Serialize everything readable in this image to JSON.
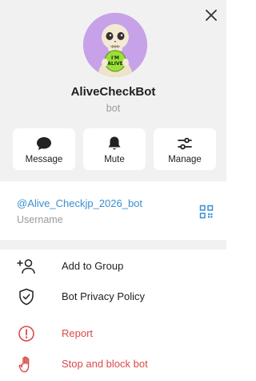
{
  "profile": {
    "name": "AliveCheckBot",
    "subtitle": "bot",
    "avatar_badge_line1": "I'M",
    "avatar_badge_line2": "ALIVE"
  },
  "actions": [
    {
      "label": "Message",
      "icon": "message-bubble-icon"
    },
    {
      "label": "Mute",
      "icon": "bell-icon"
    },
    {
      "label": "Manage",
      "icon": "sliders-icon"
    }
  ],
  "username": {
    "value": "@Alive_Checkjp_2026_bot",
    "label": "Username"
  },
  "menu": [
    {
      "label": "Add to Group",
      "icon": "add-user-icon",
      "danger": false
    },
    {
      "label": "Bot Privacy Policy",
      "icon": "shield-check-icon",
      "danger": false
    },
    {
      "label": "Report",
      "icon": "alert-circle-icon",
      "danger": true
    },
    {
      "label": "Stop and block bot",
      "icon": "hand-stop-icon",
      "danger": true
    }
  ],
  "colors": {
    "header_bg": "#f1f1f1",
    "link": "#3a8fd0",
    "danger": "#d94a4a",
    "avatar_bg": "#c7a2e8",
    "badge_green": "#9be03a"
  }
}
